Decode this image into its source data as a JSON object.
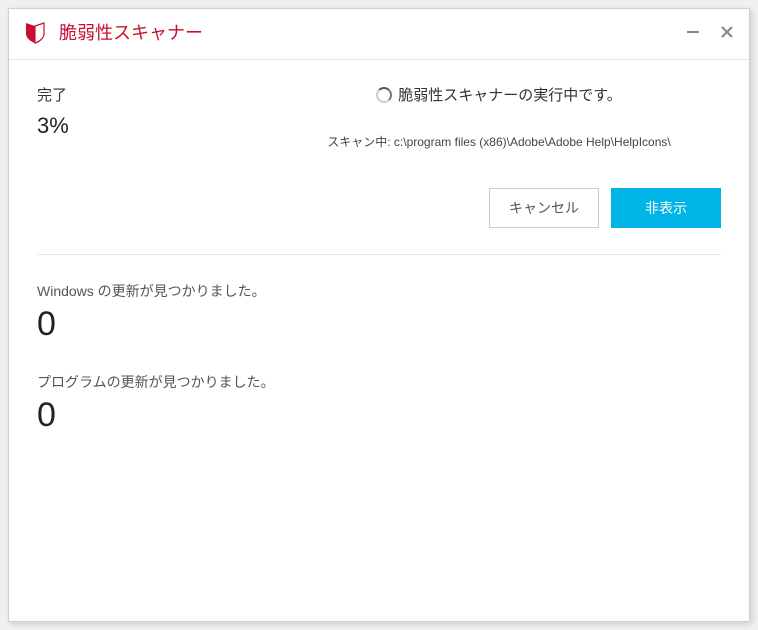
{
  "window": {
    "title": "脆弱性スキャナー"
  },
  "progress": {
    "done_label": "完了",
    "percent_text": "3%"
  },
  "running": {
    "message": "脆弱性スキャナーの実行中です。",
    "scan_label": "スキャン中: c:\\program files (x86)\\Adobe\\Adobe Help\\HelpIcons\\"
  },
  "buttons": {
    "cancel": "キャンセル",
    "hide": "非表示"
  },
  "updates": {
    "windows_label": "Windows の更新が見つかりました。",
    "windows_count": "0",
    "program_label": "プログラムの更新が見つかりました。",
    "program_count": "0"
  },
  "colors": {
    "brand_red": "#c8102e",
    "primary_button": "#00b4e6"
  }
}
